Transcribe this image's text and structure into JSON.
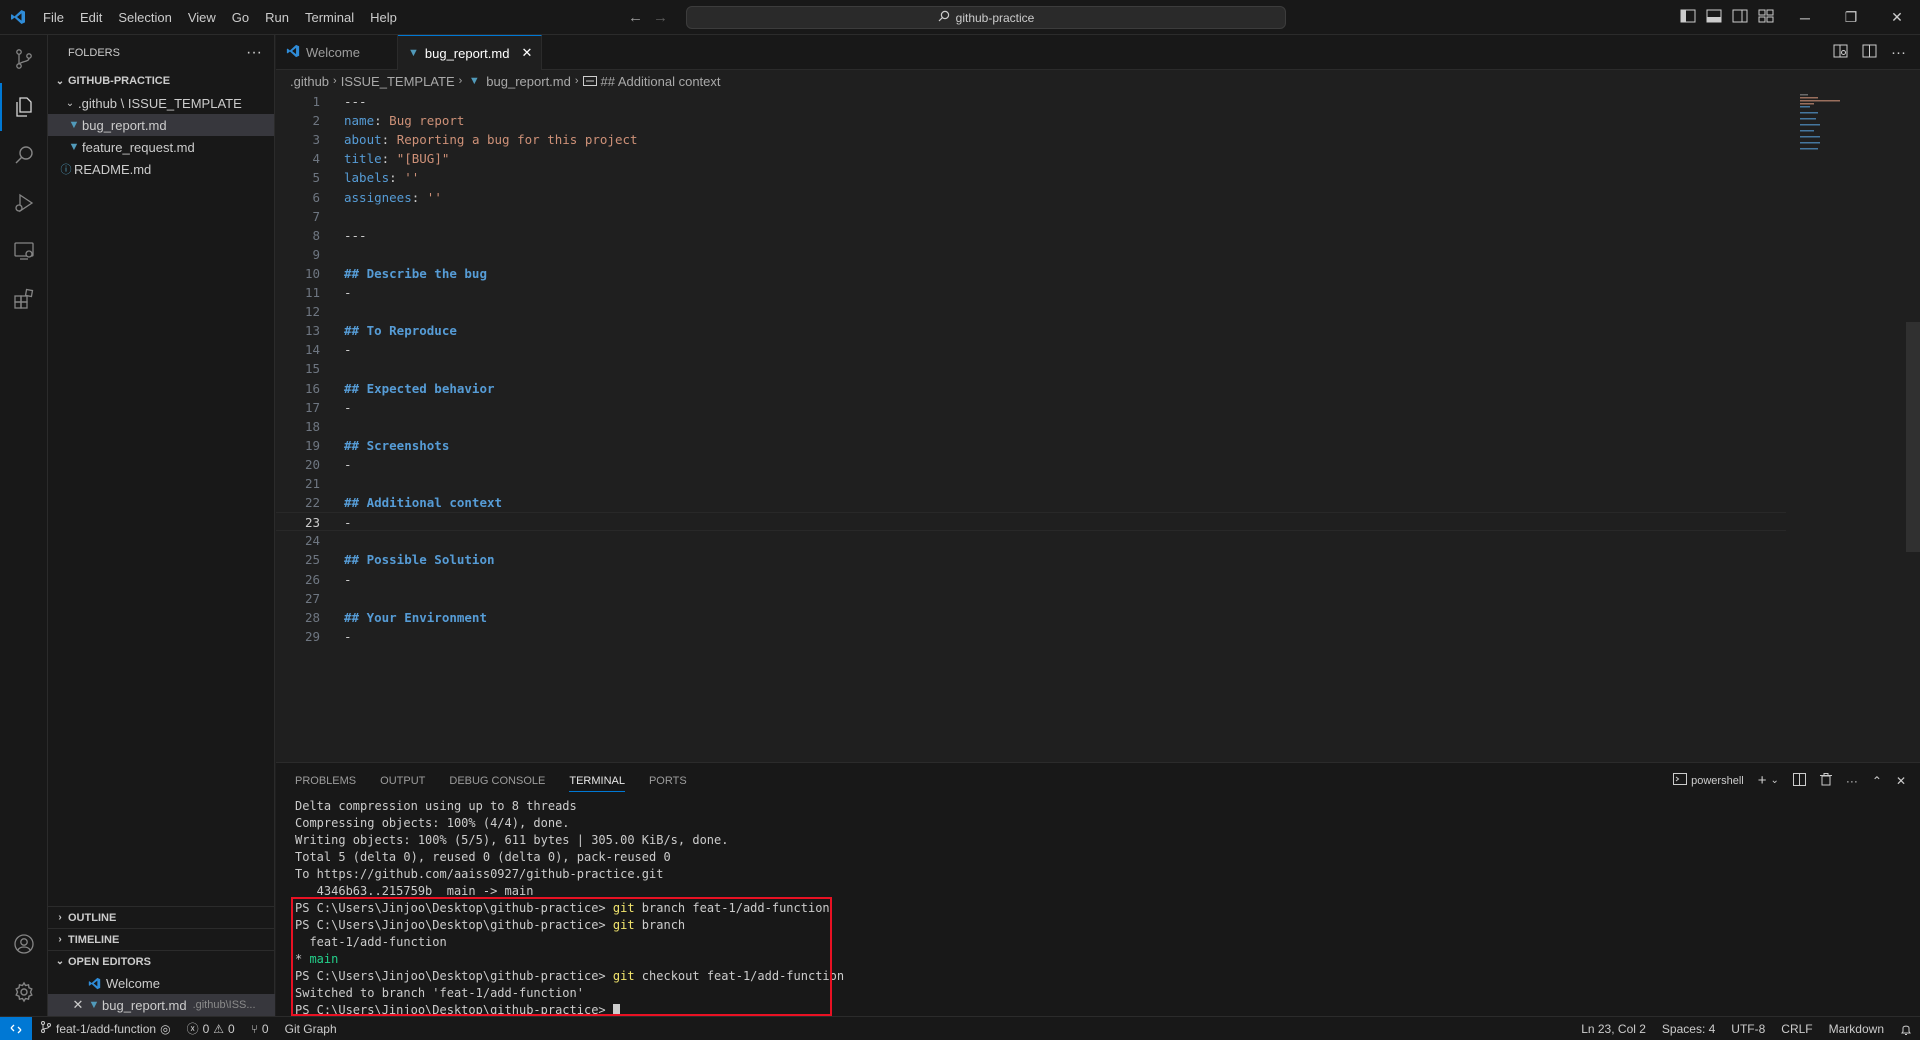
{
  "window": {
    "menu": [
      "File",
      "Edit",
      "Selection",
      "View",
      "Go",
      "Run",
      "Terminal",
      "Help"
    ],
    "search": "github-practice",
    "accent": "#0078d4"
  },
  "explorer": {
    "header": "FOLDERS",
    "root": "GITHUB-PRACTICE",
    "folder": ".github \\ ISSUE_TEMPLATE",
    "files": [
      "bug_report.md",
      "feature_request.md"
    ],
    "readme": "README.md",
    "sections": {
      "outline": "OUTLINE",
      "timeline": "TIMELINE",
      "open_editors": "OPEN EDITORS"
    },
    "open_editors": [
      {
        "label": "Welcome",
        "path": ""
      },
      {
        "label": "bug_report.md",
        "path": ".github\\ISS..."
      }
    ]
  },
  "tabs": [
    {
      "label": "Welcome"
    },
    {
      "label": "bug_report.md"
    }
  ],
  "breadcrumb": [
    ".github",
    "ISSUE_TEMPLATE",
    "bug_report.md",
    "## Additional context"
  ],
  "editor": {
    "current_line": 23,
    "lines": [
      {
        "n": "1",
        "text": "---"
      },
      {
        "n": "2",
        "key": "name",
        "val": "Bug report"
      },
      {
        "n": "3",
        "key": "about",
        "val": "Reporting a bug for this project"
      },
      {
        "n": "4",
        "key": "title",
        "val": "\"[BUG]\""
      },
      {
        "n": "5",
        "key": "labels",
        "val": "''"
      },
      {
        "n": "6",
        "key": "assignees",
        "val": "''"
      },
      {
        "n": "7",
        "text": ""
      },
      {
        "n": "8",
        "text": "---"
      },
      {
        "n": "9",
        "text": ""
      },
      {
        "n": "10",
        "head": "## Describe the bug"
      },
      {
        "n": "11",
        "text": "-"
      },
      {
        "n": "12",
        "text": ""
      },
      {
        "n": "13",
        "head": "## To Reproduce"
      },
      {
        "n": "14",
        "text": "-"
      },
      {
        "n": "15",
        "text": ""
      },
      {
        "n": "16",
        "head": "## Expected behavior"
      },
      {
        "n": "17",
        "text": "-"
      },
      {
        "n": "18",
        "text": ""
      },
      {
        "n": "19",
        "head": "## Screenshots"
      },
      {
        "n": "20",
        "text": "-"
      },
      {
        "n": "21",
        "text": ""
      },
      {
        "n": "22",
        "head": "## Additional context"
      },
      {
        "n": "23",
        "text": "-"
      },
      {
        "n": "24",
        "text": ""
      },
      {
        "n": "25",
        "head": "## Possible Solution"
      },
      {
        "n": "26",
        "text": "-"
      },
      {
        "n": "27",
        "text": ""
      },
      {
        "n": "28",
        "head": "## Your Environment"
      },
      {
        "n": "29",
        "text": "-"
      }
    ]
  },
  "panel": {
    "tabs": [
      "PROBLEMS",
      "OUTPUT",
      "DEBUG CONSOLE",
      "TERMINAL",
      "PORTS"
    ],
    "active_tab": "TERMINAL",
    "shell": "powershell",
    "terminal_lines": [
      {
        "text": "Delta compression using up to 8 threads"
      },
      {
        "text": "Compressing objects: 100% (4/4), done."
      },
      {
        "text": "Writing objects: 100% (5/5), 611 bytes | 305.00 KiB/s, done."
      },
      {
        "text": "Total 5 (delta 0), reused 0 (delta 0), pack-reused 0"
      },
      {
        "text": "To https://github.com/aaiss0927/github-practice.git"
      },
      {
        "text": "   4346b63..215759b  main -> main"
      },
      {
        "prompt": "PS C:\\Users\\Jinjoo\\Desktop\\github-practice> ",
        "cmd": "git",
        "args": " branch feat-1/add-function"
      },
      {
        "prompt": "PS C:\\Users\\Jinjoo\\Desktop\\github-practice> ",
        "cmd": "git",
        "args": " branch"
      },
      {
        "text": "  feat-1/add-function"
      },
      {
        "star": "* ",
        "green": "main"
      },
      {
        "prompt": "PS C:\\Users\\Jinjoo\\Desktop\\github-practice> ",
        "cmd": "git",
        "args": " checkout feat-1/add-function"
      },
      {
        "text": "Switched to branch 'feat-1/add-function'"
      },
      {
        "prompt": "PS C:\\Users\\Jinjoo\\Desktop\\github-practice> ",
        "cursor": true
      }
    ]
  },
  "statusbar": {
    "branch": "feat-1/add-function",
    "errors": "0",
    "warnings": "0",
    "ports": "0",
    "git_graph": "Git Graph",
    "position": "Ln 23, Col 2",
    "spaces": "Spaces: 4",
    "encoding": "UTF-8",
    "eol": "CRLF",
    "language": "Markdown"
  }
}
